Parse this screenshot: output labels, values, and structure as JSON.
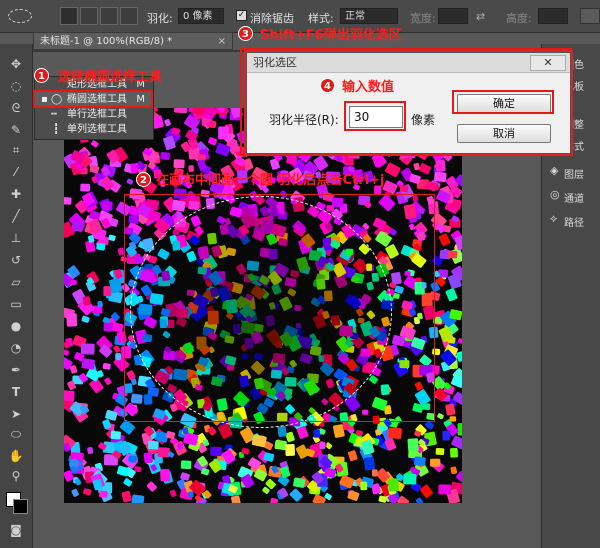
{
  "optbar": {
    "feather_label": "羽化:",
    "feather_value": "0 像素",
    "antialias_label": "消除锯齿",
    "style_label": "样式:",
    "style_value": "正常",
    "width_label": "宽度:",
    "height_label": "高度:"
  },
  "document": {
    "tab_title": "未标题-1 @ 100%(RGB/8) *"
  },
  "flyout": {
    "items": [
      {
        "label": "矩形选框工具",
        "shortcut": "M"
      },
      {
        "label": "椭圆选框工具",
        "shortcut": "M"
      },
      {
        "label": "单行选框工具",
        "shortcut": ""
      },
      {
        "label": "单列选框工具",
        "shortcut": ""
      }
    ]
  },
  "right_panel": {
    "items": [
      "颜色",
      "色板",
      "调整",
      "样式",
      "图层",
      "通道",
      "路径"
    ]
  },
  "dialog": {
    "title": "羽化选区",
    "close": "✕",
    "radius_label": "羽化半径(R):",
    "radius_value": "30",
    "unit": "像素",
    "ok": "确定",
    "cancel": "取消"
  },
  "annotations": {
    "n1": "1",
    "step1": "选择椭圆选择工具",
    "n2": "2",
    "step2": "在画布中间画一个圆 羽化后点击Ctrl+j",
    "n3": "3",
    "step3": "Shift+F6弹出羽化选区",
    "n4": "4",
    "step4": "输入数值"
  },
  "colors": {
    "accent": "#e21a1a",
    "canvas_bg": "#080808",
    "panel": "#454545"
  }
}
